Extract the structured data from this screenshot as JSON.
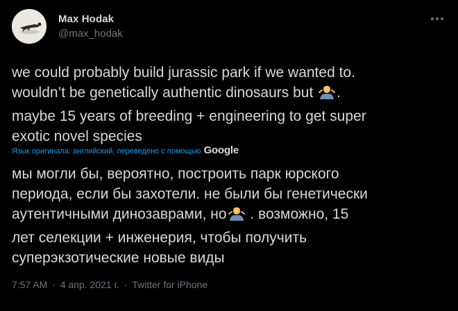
{
  "author": {
    "name": "Max Hodak",
    "handle": "@max_hodak"
  },
  "icons": {
    "avatar": "avatar-photo",
    "more": "more-options-icon",
    "shrug": "person-shrugging-emoji"
  },
  "tweet": {
    "lines": [
      "we could probably build jurassic park if we wanted to.",
      "wouldn’t be genetically authentic dinosaurs but",
      ".",
      "maybe 15 years of breeding + engineering to get super",
      "exotic novel species"
    ]
  },
  "translation": {
    "note": "Язык оригинала: английский, переведено с помощью",
    "provider": "Google",
    "lines": [
      "мы могли бы, вероятно, построить парк юрского",
      "периода, если бы захотели. не были бы генетически",
      "аутентичными динозаврами, но",
      ". возможно, 15",
      "лет селекции + инженерия, чтобы получить",
      "суперэкзотические новые виды"
    ]
  },
  "meta": {
    "time": "7:57 AM",
    "sep": "·",
    "date": "4 апр. 2021 г.",
    "source": "Twitter for iPhone"
  },
  "colors": {
    "background": "#000000",
    "text": "#d9d9d9",
    "secondary": "#6e767d",
    "link": "#1d9bf0"
  }
}
